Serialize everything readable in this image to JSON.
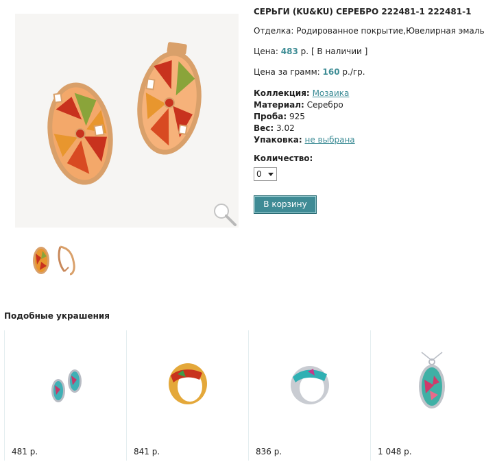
{
  "product": {
    "title": "СЕРЬГИ (KU&KU) СЕРЕБРО 222481-1 222481-1",
    "finish_label": "Отделка:",
    "finish_value": "Родированное покрытие,Ювелирная эмаль",
    "price_label": "Цена:",
    "price_value": "483",
    "price_unit": "р.",
    "availability": "[ В наличии ]",
    "gram_label": "Цена за грамм:",
    "gram_value": "160",
    "gram_unit": "р./гр.",
    "properties": [
      {
        "label": "Коллекция:",
        "value": "Мозаика",
        "link": true
      },
      {
        "label": "Материал:",
        "value": "Серебро",
        "link": false
      },
      {
        "label": "Проба:",
        "value": "925",
        "link": false
      },
      {
        "label": "Вес:",
        "value": "3.02",
        "link": false
      },
      {
        "label": "Упаковка:",
        "value": "не выбрана",
        "link": true
      }
    ],
    "quantity_label": "Количество:",
    "quantity_value": "0",
    "cart_button": "В корзину"
  },
  "similar": {
    "title": "Подобные украшения",
    "items": [
      {
        "price": "481 р.",
        "kind": "earrings"
      },
      {
        "price": "841 р.",
        "kind": "gold-ring"
      },
      {
        "price": "836 р.",
        "kind": "silver-ring"
      },
      {
        "price": "1 048 р.",
        "kind": "pendant"
      }
    ]
  },
  "icons": {
    "zoom": "magnifier-icon"
  },
  "colors": {
    "accent": "#3f8d95",
    "button": "#3f8b95",
    "enamel_red": "#c8321e",
    "enamel_orange": "#e8962e",
    "enamel_green": "#8aa43a",
    "gold": "#d9a06a"
  }
}
